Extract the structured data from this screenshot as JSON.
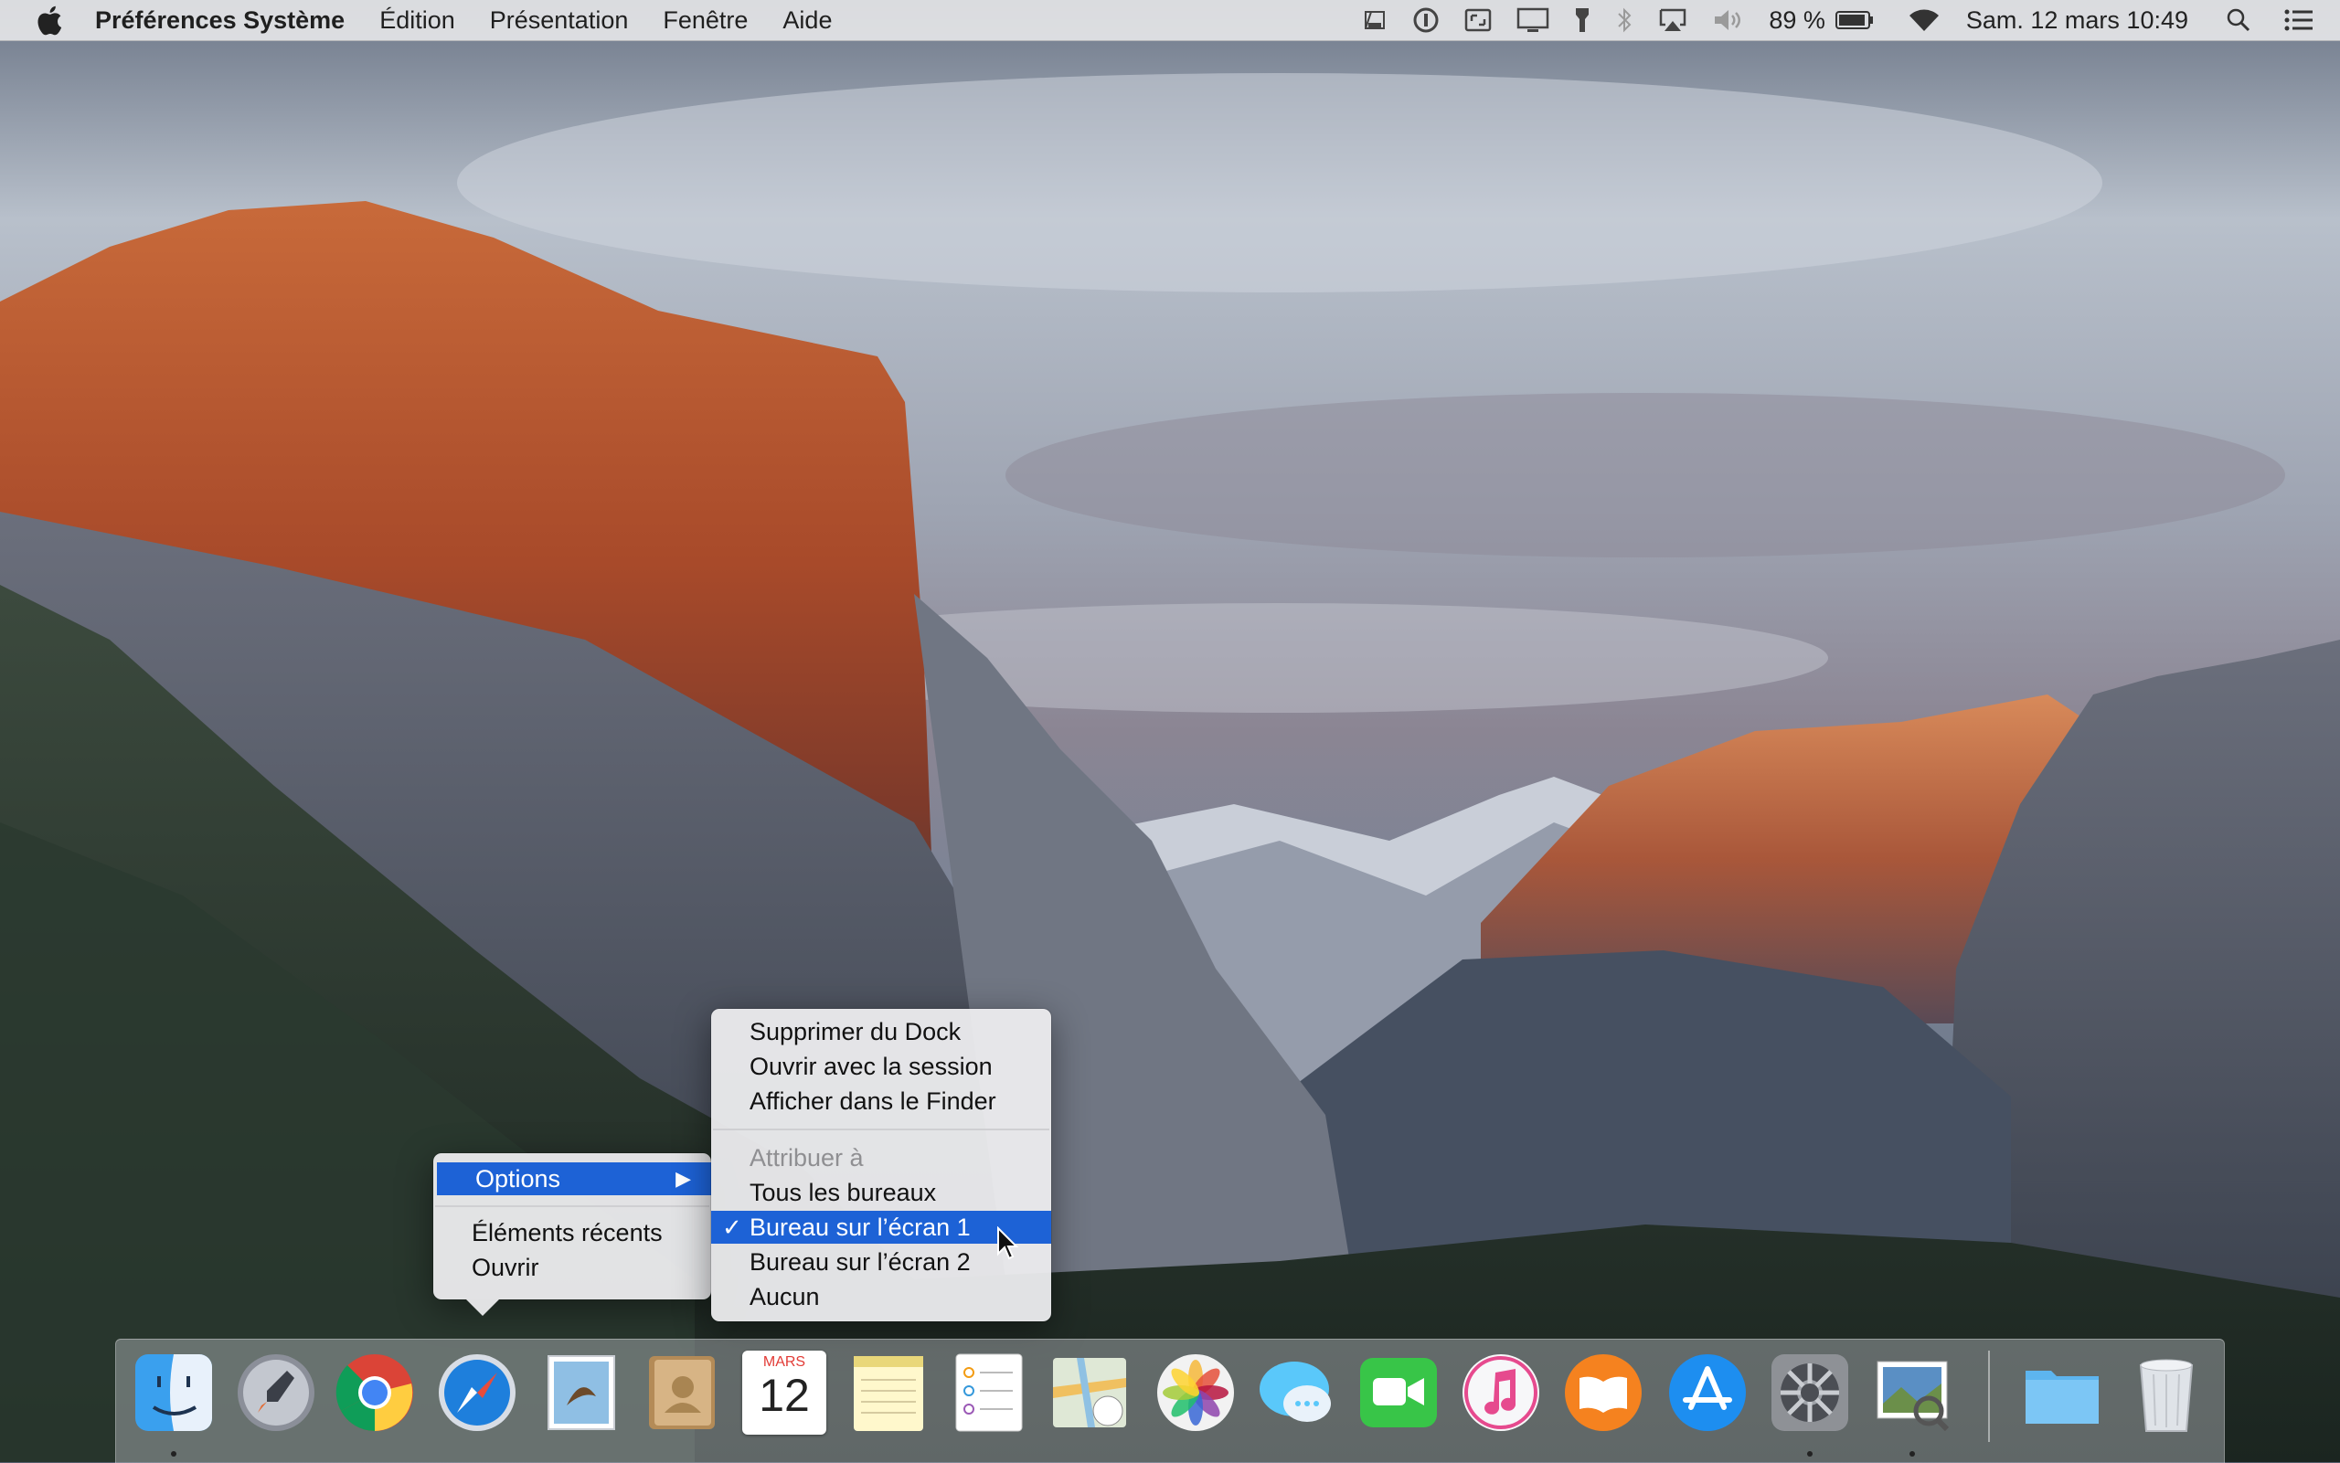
{
  "menubar": {
    "apple_icon": "apple-icon",
    "app_name": "Préférences Système",
    "menus": [
      "Édition",
      "Présentation",
      "Fenêtre",
      "Aide"
    ],
    "status": {
      "battery_percent": "89 %",
      "datetime": "Sam. 12 mars  10:49"
    },
    "status_icons": [
      "finder-sync-icon",
      "info-circle-icon",
      "screen-capture-icon",
      "display-icon",
      "flashlight-icon",
      "bluetooth-icon",
      "airplay-icon",
      "volume-icon",
      "battery-icon",
      "wifi-icon",
      "spotlight-icon",
      "notification-center-icon"
    ]
  },
  "context_menu": {
    "items": [
      "Options",
      "Éléments récents",
      "Ouvrir"
    ],
    "highlighted": "Options"
  },
  "options_submenu": {
    "items": [
      "Supprimer du Dock",
      "Ouvrir avec la session",
      "Afficher dans le Finder"
    ],
    "assign_header": "Attribuer à",
    "assign_items": [
      "Tous les bureaux",
      "Bureau sur l’écran 1",
      "Bureau sur l’écran 2",
      "Aucun"
    ],
    "checked": "Bureau sur l’écran 1",
    "check_mark": "✓"
  },
  "dock": {
    "apps": [
      "Finder",
      "Launchpad",
      "Google Chrome",
      "Safari",
      "Mail",
      "Contacts",
      "Calendrier",
      "Notes",
      "Rappels",
      "Plans",
      "Photos",
      "Messages",
      "FaceTime",
      "iTunes",
      "iBooks",
      "App Store",
      "Préférences Système",
      "Aperçu",
      "Dossier",
      "Corbeille"
    ],
    "calendar": {
      "month": "MARS",
      "day": "12"
    },
    "running": [
      "Finder",
      "Préférences Système",
      "Aperçu"
    ]
  },
  "colors": {
    "highlight": "#1d62d6",
    "menu_bg": "#ececee"
  }
}
